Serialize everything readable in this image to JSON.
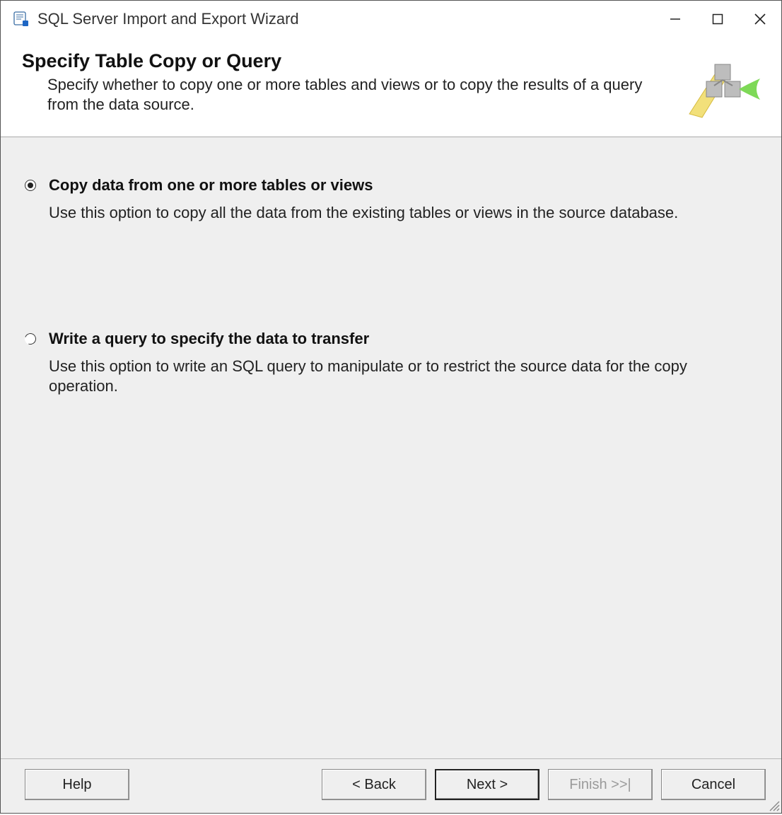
{
  "titlebar": {
    "title": "SQL Server Import and Export Wizard"
  },
  "header": {
    "title": "Specify Table Copy or Query",
    "subtitle": "Specify whether to copy one or more tables and views or to copy the results of a query from the data source."
  },
  "options": [
    {
      "label": "Copy data from one or more tables or views",
      "description": "Use this option to copy all the data from the existing tables or views in the source database.",
      "selected": true
    },
    {
      "label": "Write a query to specify the data to transfer",
      "description": "Use this option to write an SQL query to manipulate or to restrict the source data for the copy operation.",
      "selected": false
    }
  ],
  "footer": {
    "help": "Help",
    "back": "< Back",
    "next": "Next >",
    "finish": "Finish >>|",
    "cancel": "Cancel"
  }
}
